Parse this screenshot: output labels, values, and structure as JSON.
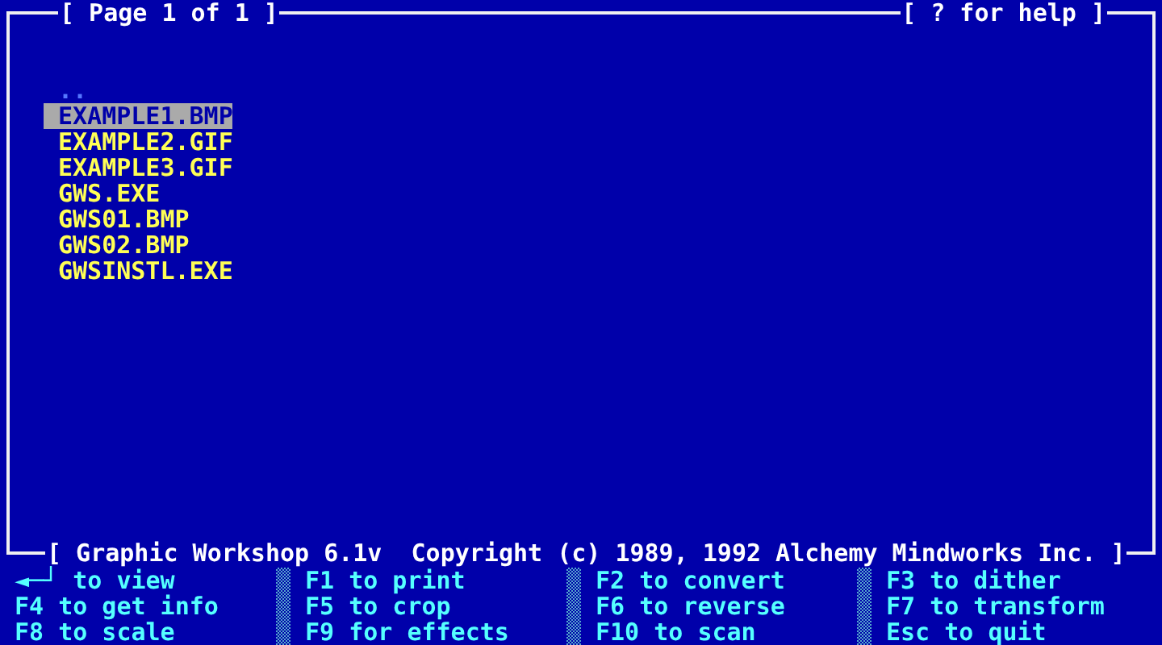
{
  "frame": {
    "title": "[ Page 1 of 1 ]",
    "help": "[ ? for help ]",
    "footer": "[ Graphic Workshop 6.1v  Copyright (c) 1989, 1992 Alchemy Mindworks Inc. ]"
  },
  "files": [
    {
      "name": "..",
      "kind": "parent",
      "selected": false
    },
    {
      "name": "EXAMPLE1.BMP",
      "kind": "file",
      "selected": true
    },
    {
      "name": "EXAMPLE2.GIF",
      "kind": "file",
      "selected": false
    },
    {
      "name": "EXAMPLE3.GIF",
      "kind": "file",
      "selected": false
    },
    {
      "name": "GWS.EXE",
      "kind": "file",
      "selected": false
    },
    {
      "name": "GWS01.BMP",
      "kind": "file",
      "selected": false
    },
    {
      "name": "GWS02.BMP",
      "kind": "file",
      "selected": false
    },
    {
      "name": "GWSINSTL.EXE",
      "kind": "file",
      "selected": false
    }
  ],
  "hints": [
    [
      "◄─┘ to view",
      "F4 to get info",
      "F8 to scale"
    ],
    [
      "F1 to print",
      "F5 to crop",
      "F9 for effects"
    ],
    [
      "F2 to convert",
      "F6 to reverse",
      "F10 to scan"
    ],
    [
      "F3 to dither",
      "F7 to transform",
      "Esc to quit"
    ]
  ]
}
